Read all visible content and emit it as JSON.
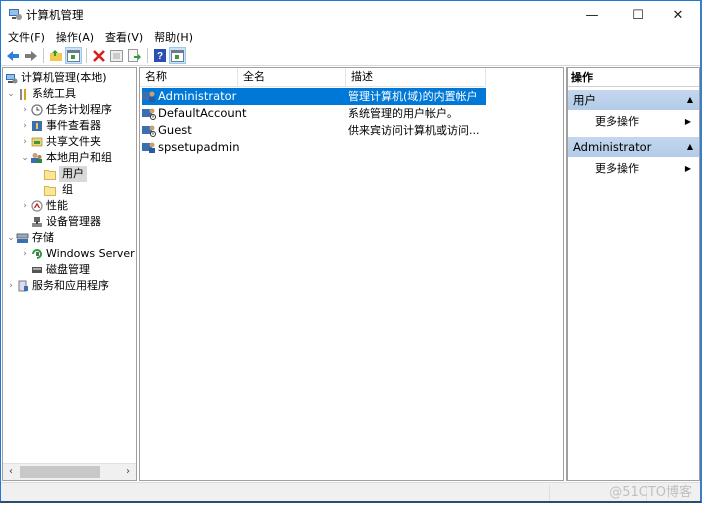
{
  "window": {
    "title": "计算机管理",
    "controls": {
      "minimize": "—",
      "maximize": "☐",
      "close": "✕"
    }
  },
  "menu": [
    {
      "label": "文件(F)"
    },
    {
      "label": "操作(A)"
    },
    {
      "label": "查看(V)"
    },
    {
      "label": "帮助(H)"
    }
  ],
  "toolbar": {
    "icons": [
      "back-arrow-icon",
      "forward-arrow-icon",
      "up-folder-icon",
      "show-hide-console-tree-icon",
      "delete-icon",
      "properties-icon",
      "export-list-icon",
      "help-icon",
      "show-hide-action-pane-icon"
    ]
  },
  "tree": {
    "items": [
      {
        "label": "计算机管理(本地)",
        "level": 0,
        "expander": ""
      },
      {
        "label": "系统工具",
        "level": 1,
        "expander": "⌄"
      },
      {
        "label": "任务计划程序",
        "level": 2,
        "expander": "›"
      },
      {
        "label": "事件查看器",
        "level": 2,
        "expander": "›"
      },
      {
        "label": "共享文件夹",
        "level": 2,
        "expander": "›"
      },
      {
        "label": "本地用户和组",
        "level": 2,
        "expander": "⌄"
      },
      {
        "label": "用户",
        "level": 3,
        "expander": "",
        "selected": true
      },
      {
        "label": "组",
        "level": 3,
        "expander": ""
      },
      {
        "label": "性能",
        "level": 2,
        "expander": "›"
      },
      {
        "label": "设备管理器",
        "level": 2,
        "expander": ""
      },
      {
        "label": "存储",
        "level": 1,
        "expander": "⌄"
      },
      {
        "label": "Windows Server",
        "level": 2,
        "expander": "›"
      },
      {
        "label": "磁盘管理",
        "level": 2,
        "expander": ""
      },
      {
        "label": "服务和应用程序",
        "level": 1,
        "expander": "›"
      }
    ],
    "scroll": {
      "left": "‹",
      "right": "›"
    }
  },
  "list": {
    "columns": [
      "名称",
      "全名",
      "描述"
    ],
    "rows": [
      {
        "name": "Administrator",
        "fullname": "",
        "description": "管理计算机(域)的内置帐户",
        "selected": true
      },
      {
        "name": "DefaultAccount",
        "fullname": "",
        "description": "系统管理的用户帐户。"
      },
      {
        "name": "Guest",
        "fullname": "",
        "description": "供来宾访问计算机或访问..."
      },
      {
        "name": "spsetupadmin",
        "fullname": "",
        "description": ""
      }
    ]
  },
  "actions": {
    "title": "操作",
    "sections": [
      {
        "header": "用户",
        "collapse_glyph": "▲",
        "items": [
          {
            "label": "更多操作",
            "arrow": "▶"
          }
        ]
      },
      {
        "header": "Administrator",
        "collapse_glyph": "▲",
        "items": [
          {
            "label": "更多操作",
            "arrow": "▶"
          }
        ]
      }
    ]
  },
  "status": {
    "watermark": "@51CTO博客"
  },
  "colors": {
    "selection": "#0078d7",
    "border": "#1e7bd4",
    "action_header": "#bcd2ec"
  }
}
